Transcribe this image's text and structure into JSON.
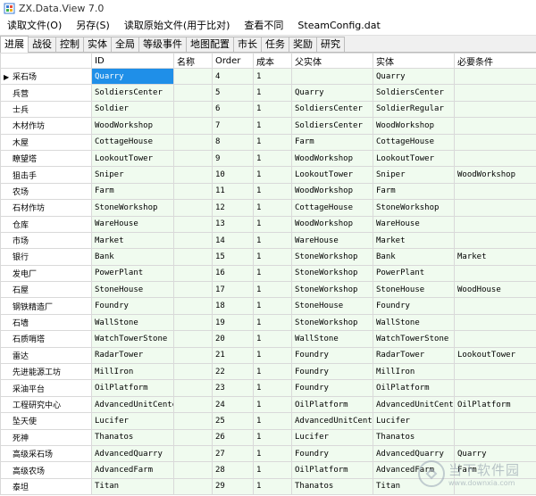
{
  "window": {
    "title": "ZX.Data.View 7.0"
  },
  "menu": [
    {
      "id": "read-file",
      "label": "读取文件(O)"
    },
    {
      "id": "save-as",
      "label": "另存(S)"
    },
    {
      "id": "read-original",
      "label": "读取原始文件(用于比对)"
    },
    {
      "id": "view-diff",
      "label": "查看不同"
    },
    {
      "id": "steam-config",
      "label": "SteamConfig.dat"
    }
  ],
  "tabs": [
    {
      "label": "进展",
      "active": true
    },
    {
      "label": "战役"
    },
    {
      "label": "控制"
    },
    {
      "label": "实体"
    },
    {
      "label": "全局"
    },
    {
      "label": "等级事件"
    },
    {
      "label": "地图配置"
    },
    {
      "label": "市长"
    },
    {
      "label": "任务"
    },
    {
      "label": "奖励"
    },
    {
      "label": "研究"
    }
  ],
  "grid": {
    "columns": [
      "",
      "ID",
      "名称",
      "Order",
      "成本",
      "父实体",
      "实体",
      "必要条件"
    ],
    "selected_row": 0,
    "rows": [
      {
        "name": "采石场",
        "cells": [
          "Quarry",
          "",
          "4",
          "1",
          "",
          "Quarry",
          ""
        ]
      },
      {
        "name": "兵营",
        "cells": [
          "SoldiersCenter",
          "",
          "5",
          "1",
          "Quarry",
          "SoldiersCenter",
          ""
        ]
      },
      {
        "name": "士兵",
        "cells": [
          "Soldier",
          "",
          "6",
          "1",
          "SoldiersCenter",
          "SoldierRegular",
          ""
        ]
      },
      {
        "name": "木材作坊",
        "cells": [
          "WoodWorkshop",
          "",
          "7",
          "1",
          "SoldiersCenter",
          "WoodWorkshop",
          ""
        ]
      },
      {
        "name": "木屋",
        "cells": [
          "CottageHouse",
          "",
          "8",
          "1",
          "Farm",
          "CottageHouse",
          ""
        ]
      },
      {
        "name": "瞭望塔",
        "cells": [
          "LookoutTower",
          "",
          "9",
          "1",
          "WoodWorkshop",
          "LookoutTower",
          ""
        ]
      },
      {
        "name": "狙击手",
        "cells": [
          "Sniper",
          "",
          "10",
          "1",
          "LookoutTower",
          "Sniper",
          "WoodWorkshop"
        ]
      },
      {
        "name": "农场",
        "cells": [
          "Farm",
          "",
          "11",
          "1",
          "WoodWorkshop",
          "Farm",
          ""
        ]
      },
      {
        "name": "石材作坊",
        "cells": [
          "StoneWorkshop",
          "",
          "12",
          "1",
          "CottageHouse",
          "StoneWorkshop",
          ""
        ]
      },
      {
        "name": "仓库",
        "cells": [
          "WareHouse",
          "",
          "13",
          "1",
          "WoodWorkshop",
          "WareHouse",
          ""
        ]
      },
      {
        "name": "市场",
        "cells": [
          "Market",
          "",
          "14",
          "1",
          "WareHouse",
          "Market",
          ""
        ]
      },
      {
        "name": "银行",
        "cells": [
          "Bank",
          "",
          "15",
          "1",
          "StoneWorkshop",
          "Bank",
          "Market"
        ]
      },
      {
        "name": "发电厂",
        "cells": [
          "PowerPlant",
          "",
          "16",
          "1",
          "StoneWorkshop",
          "PowerPlant",
          ""
        ]
      },
      {
        "name": "石屋",
        "cells": [
          "StoneHouse",
          "",
          "17",
          "1",
          "StoneWorkshop",
          "StoneHouse",
          "WoodHouse"
        ]
      },
      {
        "name": "钢铁精造厂",
        "cells": [
          "Foundry",
          "",
          "18",
          "1",
          "StoneHouse",
          "Foundry",
          ""
        ]
      },
      {
        "name": "石墙",
        "cells": [
          "WallStone",
          "",
          "19",
          "1",
          "StoneWorkshop",
          "WallStone",
          ""
        ]
      },
      {
        "name": "石质哨塔",
        "cells": [
          "WatchTowerStone",
          "",
          "20",
          "1",
          "WallStone",
          "WatchTowerStone",
          ""
        ]
      },
      {
        "name": "雷达",
        "cells": [
          "RadarTower",
          "",
          "21",
          "1",
          "Foundry",
          "RadarTower",
          "LookoutTower"
        ]
      },
      {
        "name": "先进能源工坊",
        "cells": [
          "MillIron",
          "",
          "22",
          "1",
          "Foundry",
          "MillIron",
          ""
        ]
      },
      {
        "name": "采油平台",
        "cells": [
          "OilPlatform",
          "",
          "23",
          "1",
          "Foundry",
          "OilPlatform",
          ""
        ]
      },
      {
        "name": "工程研究中心",
        "cells": [
          "AdvancedUnitCenter",
          "",
          "24",
          "1",
          "OilPlatform",
          "AdvancedUnitCenter",
          "OilPlatform"
        ]
      },
      {
        "name": "坠天使",
        "cells": [
          "Lucifer",
          "",
          "25",
          "1",
          "AdvancedUnitCenter",
          "Lucifer",
          ""
        ]
      },
      {
        "name": "死神",
        "cells": [
          "Thanatos",
          "",
          "26",
          "1",
          "Lucifer",
          "Thanatos",
          ""
        ]
      },
      {
        "name": "高级采石场",
        "cells": [
          "AdvancedQuarry",
          "",
          "27",
          "1",
          "Foundry",
          "AdvancedQuarry",
          "Quarry"
        ]
      },
      {
        "name": "高级农场",
        "cells": [
          "AdvancedFarm",
          "",
          "28",
          "1",
          "OilPlatform",
          "AdvancedFarm",
          "Farm"
        ]
      },
      {
        "name": "泰坦",
        "cells": [
          "Titan",
          "",
          "29",
          "1",
          "Thanatos",
          "Titan",
          ""
        ]
      }
    ]
  },
  "watermark": {
    "cn": "当下软件园",
    "en": "www.downxia.com"
  },
  "colors": {
    "cell_bg": "#f0fbef",
    "selected": "#1f8fe8",
    "grid_line": "#d9d9d9"
  },
  "icons": {
    "app": "app-logo-icon",
    "row_pointer": "row-pointer-icon"
  }
}
